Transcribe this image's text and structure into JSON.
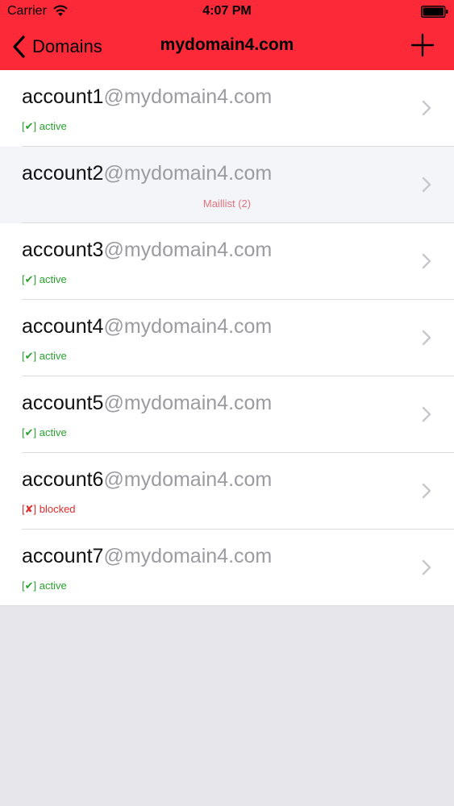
{
  "status_bar": {
    "carrier": "Carrier",
    "time": "4:07 PM"
  },
  "nav": {
    "back_label": "Domains",
    "title": "mydomain4.com"
  },
  "colors": {
    "accent": "#fc2a38",
    "active": "#27a32d",
    "blocked": "#e52b2b",
    "maillist": "#e4727d"
  },
  "accounts": [
    {
      "user": "account1",
      "domain": "@mydomain4.com",
      "status": "[✔] active",
      "status_type": "active"
    },
    {
      "user": "account2",
      "domain": "@mydomain4.com",
      "status": "Maillist (2)",
      "status_type": "maillist"
    },
    {
      "user": "account3",
      "domain": "@mydomain4.com",
      "status": "[✔] active",
      "status_type": "active"
    },
    {
      "user": "account4",
      "domain": "@mydomain4.com",
      "status": "[✔] active",
      "status_type": "active"
    },
    {
      "user": "account5",
      "domain": "@mydomain4.com",
      "status": "[✔] active",
      "status_type": "active"
    },
    {
      "user": "account6",
      "domain": "@mydomain4.com",
      "status": "[✘] blocked",
      "status_type": "blocked"
    },
    {
      "user": "account7",
      "domain": "@mydomain4.com",
      "status": "[✔] active",
      "status_type": "active"
    }
  ]
}
